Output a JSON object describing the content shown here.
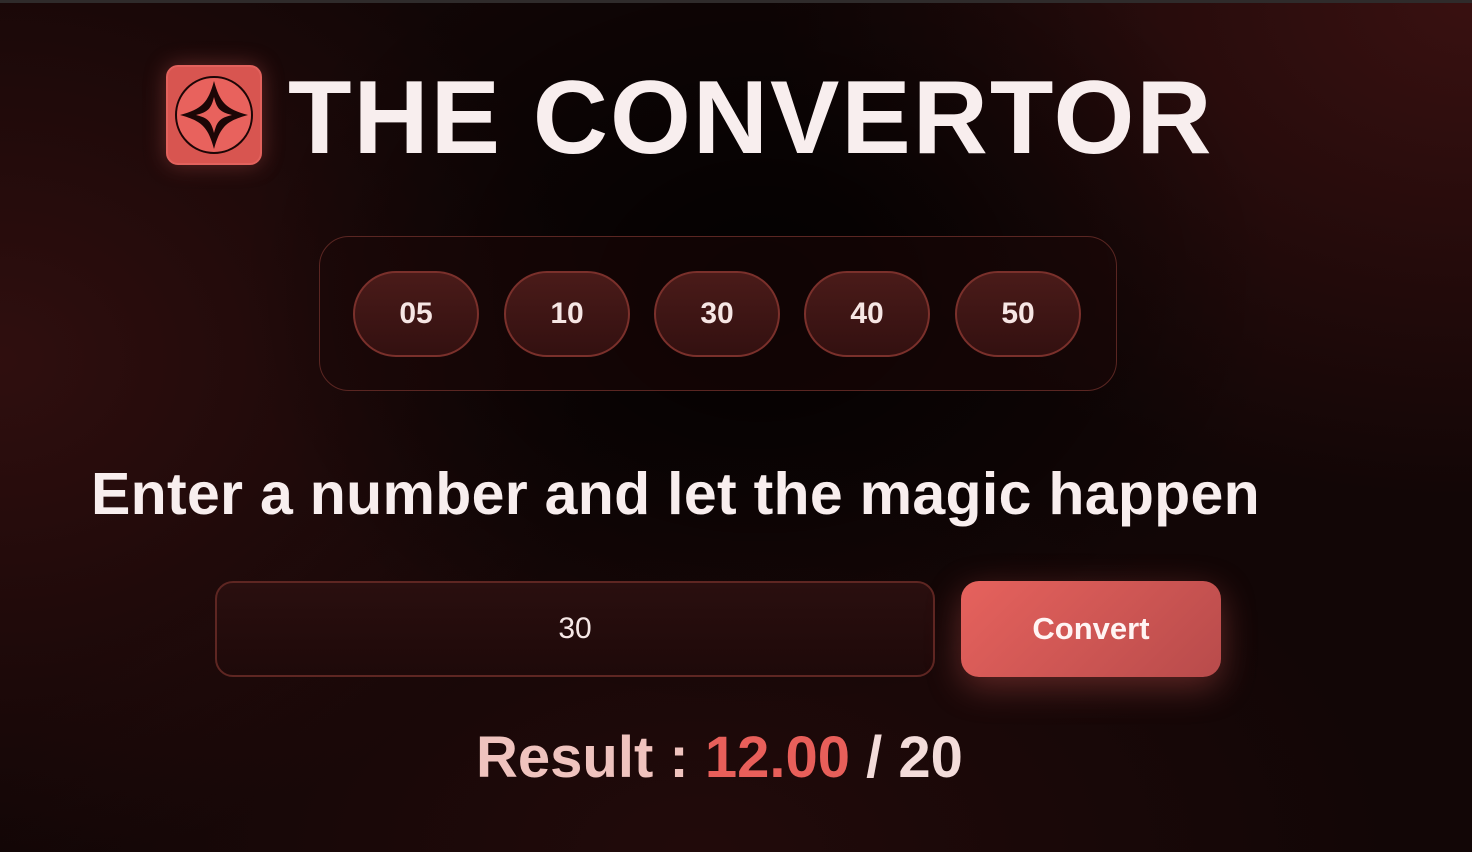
{
  "header": {
    "logo_icon": "diamond-star-icon",
    "title": "THE CONVERTOR"
  },
  "presets": [
    "05",
    "10",
    "30",
    "40",
    "50"
  ],
  "prompt": "Enter a number and let the magic happen",
  "input": {
    "value": "30",
    "placeholder": ""
  },
  "convert_button": {
    "label": "Convert"
  },
  "result": {
    "label": "Result :",
    "value": "12.00",
    "separator": "/",
    "max": "20"
  },
  "colors": {
    "accent": "#e2625d",
    "background": "#120606",
    "text": "#f8eeee"
  }
}
